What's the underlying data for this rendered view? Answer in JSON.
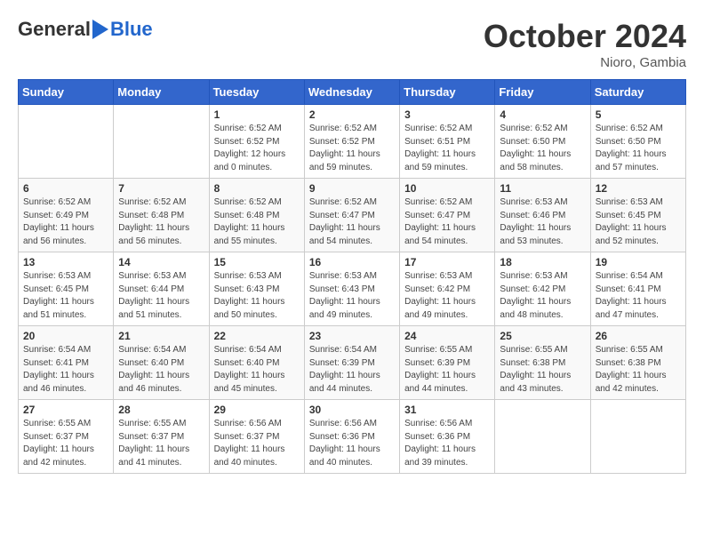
{
  "header": {
    "logo_general": "General",
    "logo_blue": "Blue",
    "month": "October 2024",
    "location": "Nioro, Gambia"
  },
  "days_of_week": [
    "Sunday",
    "Monday",
    "Tuesday",
    "Wednesday",
    "Thursday",
    "Friday",
    "Saturday"
  ],
  "weeks": [
    [
      {
        "day": "",
        "info": ""
      },
      {
        "day": "",
        "info": ""
      },
      {
        "day": "1",
        "info": "Sunrise: 6:52 AM\nSunset: 6:52 PM\nDaylight: 12 hours\nand 0 minutes."
      },
      {
        "day": "2",
        "info": "Sunrise: 6:52 AM\nSunset: 6:52 PM\nDaylight: 11 hours\nand 59 minutes."
      },
      {
        "day": "3",
        "info": "Sunrise: 6:52 AM\nSunset: 6:51 PM\nDaylight: 11 hours\nand 59 minutes."
      },
      {
        "day": "4",
        "info": "Sunrise: 6:52 AM\nSunset: 6:50 PM\nDaylight: 11 hours\nand 58 minutes."
      },
      {
        "day": "5",
        "info": "Sunrise: 6:52 AM\nSunset: 6:50 PM\nDaylight: 11 hours\nand 57 minutes."
      }
    ],
    [
      {
        "day": "6",
        "info": "Sunrise: 6:52 AM\nSunset: 6:49 PM\nDaylight: 11 hours\nand 56 minutes."
      },
      {
        "day": "7",
        "info": "Sunrise: 6:52 AM\nSunset: 6:48 PM\nDaylight: 11 hours\nand 56 minutes."
      },
      {
        "day": "8",
        "info": "Sunrise: 6:52 AM\nSunset: 6:48 PM\nDaylight: 11 hours\nand 55 minutes."
      },
      {
        "day": "9",
        "info": "Sunrise: 6:52 AM\nSunset: 6:47 PM\nDaylight: 11 hours\nand 54 minutes."
      },
      {
        "day": "10",
        "info": "Sunrise: 6:52 AM\nSunset: 6:47 PM\nDaylight: 11 hours\nand 54 minutes."
      },
      {
        "day": "11",
        "info": "Sunrise: 6:53 AM\nSunset: 6:46 PM\nDaylight: 11 hours\nand 53 minutes."
      },
      {
        "day": "12",
        "info": "Sunrise: 6:53 AM\nSunset: 6:45 PM\nDaylight: 11 hours\nand 52 minutes."
      }
    ],
    [
      {
        "day": "13",
        "info": "Sunrise: 6:53 AM\nSunset: 6:45 PM\nDaylight: 11 hours\nand 51 minutes."
      },
      {
        "day": "14",
        "info": "Sunrise: 6:53 AM\nSunset: 6:44 PM\nDaylight: 11 hours\nand 51 minutes."
      },
      {
        "day": "15",
        "info": "Sunrise: 6:53 AM\nSunset: 6:43 PM\nDaylight: 11 hours\nand 50 minutes."
      },
      {
        "day": "16",
        "info": "Sunrise: 6:53 AM\nSunset: 6:43 PM\nDaylight: 11 hours\nand 49 minutes."
      },
      {
        "day": "17",
        "info": "Sunrise: 6:53 AM\nSunset: 6:42 PM\nDaylight: 11 hours\nand 49 minutes."
      },
      {
        "day": "18",
        "info": "Sunrise: 6:53 AM\nSunset: 6:42 PM\nDaylight: 11 hours\nand 48 minutes."
      },
      {
        "day": "19",
        "info": "Sunrise: 6:54 AM\nSunset: 6:41 PM\nDaylight: 11 hours\nand 47 minutes."
      }
    ],
    [
      {
        "day": "20",
        "info": "Sunrise: 6:54 AM\nSunset: 6:41 PM\nDaylight: 11 hours\nand 46 minutes."
      },
      {
        "day": "21",
        "info": "Sunrise: 6:54 AM\nSunset: 6:40 PM\nDaylight: 11 hours\nand 46 minutes."
      },
      {
        "day": "22",
        "info": "Sunrise: 6:54 AM\nSunset: 6:40 PM\nDaylight: 11 hours\nand 45 minutes."
      },
      {
        "day": "23",
        "info": "Sunrise: 6:54 AM\nSunset: 6:39 PM\nDaylight: 11 hours\nand 44 minutes."
      },
      {
        "day": "24",
        "info": "Sunrise: 6:55 AM\nSunset: 6:39 PM\nDaylight: 11 hours\nand 44 minutes."
      },
      {
        "day": "25",
        "info": "Sunrise: 6:55 AM\nSunset: 6:38 PM\nDaylight: 11 hours\nand 43 minutes."
      },
      {
        "day": "26",
        "info": "Sunrise: 6:55 AM\nSunset: 6:38 PM\nDaylight: 11 hours\nand 42 minutes."
      }
    ],
    [
      {
        "day": "27",
        "info": "Sunrise: 6:55 AM\nSunset: 6:37 PM\nDaylight: 11 hours\nand 42 minutes."
      },
      {
        "day": "28",
        "info": "Sunrise: 6:55 AM\nSunset: 6:37 PM\nDaylight: 11 hours\nand 41 minutes."
      },
      {
        "day": "29",
        "info": "Sunrise: 6:56 AM\nSunset: 6:37 PM\nDaylight: 11 hours\nand 40 minutes."
      },
      {
        "day": "30",
        "info": "Sunrise: 6:56 AM\nSunset: 6:36 PM\nDaylight: 11 hours\nand 40 minutes."
      },
      {
        "day": "31",
        "info": "Sunrise: 6:56 AM\nSunset: 6:36 PM\nDaylight: 11 hours\nand 39 minutes."
      },
      {
        "day": "",
        "info": ""
      },
      {
        "day": "",
        "info": ""
      }
    ]
  ]
}
